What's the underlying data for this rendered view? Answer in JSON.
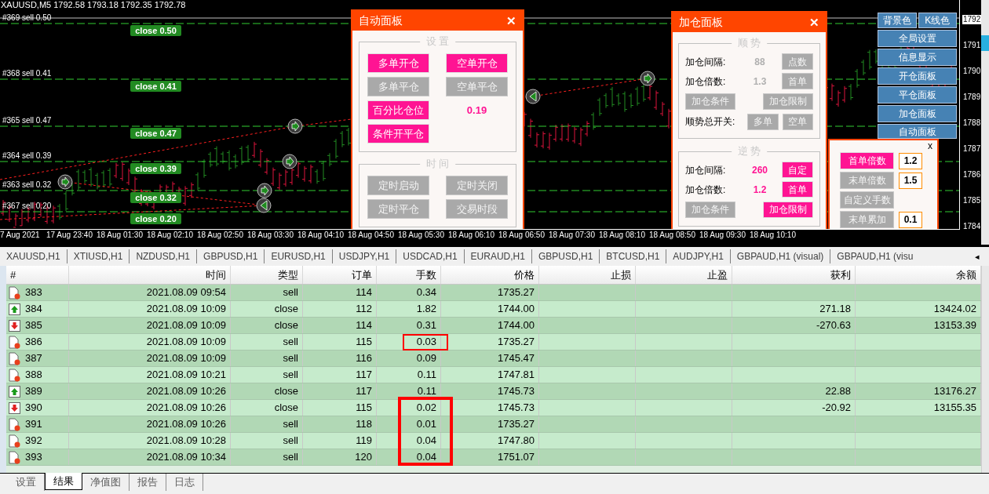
{
  "chart": {
    "title": "XAUUSD,M5 1792.58 1793.18 1792.35 1792.78",
    "order_lines": [
      {
        "label": "#369 sell 0.50",
        "button": "close 0.50"
      },
      {
        "label": "#368 sell 0.41",
        "button": "close 0.41"
      },
      {
        "label": "#365 sell 0.47",
        "button": "close 0.47"
      },
      {
        "label": "#364 sell 0.39",
        "button": "close 0.39"
      },
      {
        "label": "#363 sell 0.32",
        "button": "close 0.32"
      },
      {
        "label": "#367 sell 0.20",
        "button": "close 0.20"
      }
    ],
    "time_labels": [
      "7 Aug 2021",
      "17 Aug 23:40",
      "18 Aug 01:30",
      "18 Aug 02:10",
      "18 Aug 02:50",
      "18 Aug 03:30",
      "18 Aug 04:10",
      "18 Aug 04:50",
      "18 Aug 05:30",
      "18 Aug 06:10",
      "18 Aug 06:50",
      "18 Aug 07:30",
      "18 Aug 08:10",
      "18 Aug 08:50",
      "18 Aug 09:30",
      "18 Aug 10:10"
    ],
    "price_labels": [
      {
        "text": "1792",
        "current": true
      },
      {
        "text": "1791",
        "current": false
      },
      {
        "text": "1790",
        "current": false
      },
      {
        "text": "1789",
        "current": false
      },
      {
        "text": "1788",
        "current": false
      },
      {
        "text": "1787",
        "current": false
      },
      {
        "text": "1786",
        "current": false
      },
      {
        "text": "1785",
        "current": false
      },
      {
        "text": "1784",
        "current": false
      }
    ]
  },
  "auto_panel": {
    "title": "自动面板",
    "close": "✕",
    "groups": [
      {
        "title": "设 置",
        "items": [
          {
            "kind": "button",
            "label": "多单开仓",
            "on": true
          },
          {
            "kind": "button",
            "label": "空单开仓",
            "on": true
          },
          {
            "kind": "button",
            "label": "多单平仓",
            "on": false
          },
          {
            "kind": "button",
            "label": "空单平仓",
            "on": false
          },
          {
            "kind": "button",
            "label": "百分比仓位",
            "on": true
          },
          {
            "kind": "value",
            "text": "0.19"
          },
          {
            "kind": "button",
            "label": "条件开平仓",
            "on": true
          }
        ]
      },
      {
        "title": "时 间",
        "items": [
          {
            "kind": "button",
            "label": "定时启动",
            "on": false
          },
          {
            "kind": "button",
            "label": "定时关闭",
            "on": false
          },
          {
            "kind": "button",
            "label": "定时平仓",
            "on": false
          },
          {
            "kind": "button",
            "label": "交易时段",
            "on": false
          }
        ]
      }
    ]
  },
  "add_panel": {
    "title": "加仓面板",
    "close": "✕",
    "groups": [
      {
        "title": "顺 势",
        "rows": [
          {
            "kind": "field",
            "label": "加仓间隔:",
            "value": "88",
            "active": false,
            "button": {
              "label": "点数",
              "on": false
            }
          },
          {
            "kind": "field",
            "label": "加仓倍数:",
            "value": "1.3",
            "active": false,
            "button": {
              "label": "首单",
              "on": false
            }
          },
          {
            "kind": "pair",
            "buttons": [
              {
                "label": "加仓条件",
                "on": false
              },
              {
                "label": "加仓限制",
                "on": false
              }
            ]
          },
          {
            "kind": "switch",
            "label": "顺势总开关:",
            "buttons": [
              {
                "label": "多单",
                "on": false
              },
              {
                "label": "空单",
                "on": false
              }
            ]
          }
        ]
      },
      {
        "title": "逆 势",
        "rows": [
          {
            "kind": "field",
            "label": "加仓间隔:",
            "value": "260",
            "active": true,
            "button": {
              "label": "自定",
              "on": true
            }
          },
          {
            "kind": "field",
            "label": "加仓倍数:",
            "value": "1.2",
            "active": true,
            "button": {
              "label": "首单",
              "on": true
            }
          },
          {
            "kind": "pair",
            "buttons": [
              {
                "label": "加仓条件",
                "on": false
              },
              {
                "label": "加仓限制",
                "on": true
              }
            ]
          }
        ]
      }
    ]
  },
  "menu": {
    "top": [
      "背景色",
      "K线色"
    ],
    "items": [
      "全局设置",
      "信息显示",
      "开仓面板",
      "平仓面板",
      "加仓面板",
      "自动面板"
    ]
  },
  "lot_panel": {
    "close": "x",
    "rows": [
      {
        "label": "首单倍数",
        "on": true,
        "value": "1.2"
      },
      {
        "label": "末单倍数",
        "on": false,
        "value": "1.5"
      },
      {
        "label": "自定义手数",
        "on": false
      },
      {
        "label": "末单累加",
        "on": false,
        "value": "0.1"
      }
    ]
  },
  "symbol_tabs": [
    "XAUUSD,H1",
    "XTIUSD,H1",
    "NZDUSD,H1",
    "GBPUSD,H1",
    "EURUSD,H1",
    "USDJPY,H1",
    "USDCAD,H1",
    "EURAUD,H1",
    "GBPUSD,H1",
    "BTCUSD,H1",
    "AUDJPY,H1",
    "GBPAUD,H1 (visual)",
    "GBPAUD,H1 (visu"
  ],
  "tabs_arrow": "◂",
  "table": {
    "columns": [
      "#",
      "时间",
      "类型",
      "订单",
      "手数",
      "价格",
      "止损",
      "止盈",
      "获利",
      "余额"
    ],
    "rows": [
      {
        "kind": "order",
        "num": "383",
        "time": "2021.08.09 09:54",
        "type": "sell",
        "order": "114",
        "lots": "0.34",
        "price": "1735.27",
        "marked": false
      },
      {
        "kind": "profit",
        "num": "384",
        "time": "2021.08.09 10:09",
        "type": "close",
        "order": "112",
        "lots": "1.82",
        "price": "1744.00",
        "profit": "271.18",
        "balance": "13424.02",
        "marked": false
      },
      {
        "kind": "loss",
        "num": "385",
        "time": "2021.08.09 10:09",
        "type": "close",
        "order": "114",
        "lots": "0.31",
        "price": "1744.00",
        "profit": "-270.63",
        "balance": "13153.39",
        "marked": false
      },
      {
        "kind": "order",
        "num": "386",
        "time": "2021.08.09 10:09",
        "type": "sell",
        "order": "115",
        "lots": "0.03",
        "price": "1735.27",
        "marked": true
      },
      {
        "kind": "order",
        "num": "387",
        "time": "2021.08.09 10:09",
        "type": "sell",
        "order": "116",
        "lots": "0.09",
        "price": "1745.47",
        "marked": false
      },
      {
        "kind": "order",
        "num": "388",
        "time": "2021.08.09 10:21",
        "type": "sell",
        "order": "117",
        "lots": "0.11",
        "price": "1747.81",
        "marked": false
      },
      {
        "kind": "profit",
        "num": "389",
        "time": "2021.08.09 10:26",
        "type": "close",
        "order": "117",
        "lots": "0.11",
        "price": "1745.73",
        "profit": "22.88",
        "balance": "13176.27",
        "marked": false
      },
      {
        "kind": "loss",
        "num": "390",
        "time": "2021.08.09 10:26",
        "type": "close",
        "order": "115",
        "lots": "0.02",
        "price": "1745.73",
        "profit": "-20.92",
        "balance": "13155.35",
        "marked": true
      },
      {
        "kind": "order",
        "num": "391",
        "time": "2021.08.09 10:26",
        "type": "sell",
        "order": "118",
        "lots": "0.01",
        "price": "1735.27",
        "marked": true
      },
      {
        "kind": "order",
        "num": "392",
        "time": "2021.08.09 10:28",
        "type": "sell",
        "order": "119",
        "lots": "0.04",
        "price": "1747.80",
        "marked": true
      },
      {
        "kind": "order",
        "num": "393",
        "time": "2021.08.09 10:34",
        "type": "sell",
        "order": "120",
        "lots": "0.04",
        "price": "1751.07",
        "marked": true
      }
    ]
  },
  "bottom_tabs": [
    {
      "label": "设置",
      "selected": false
    },
    {
      "label": "结果",
      "selected": true
    },
    {
      "label": "净值图",
      "selected": false
    },
    {
      "label": "报告",
      "selected": false
    },
    {
      "label": "日志",
      "selected": false
    }
  ]
}
